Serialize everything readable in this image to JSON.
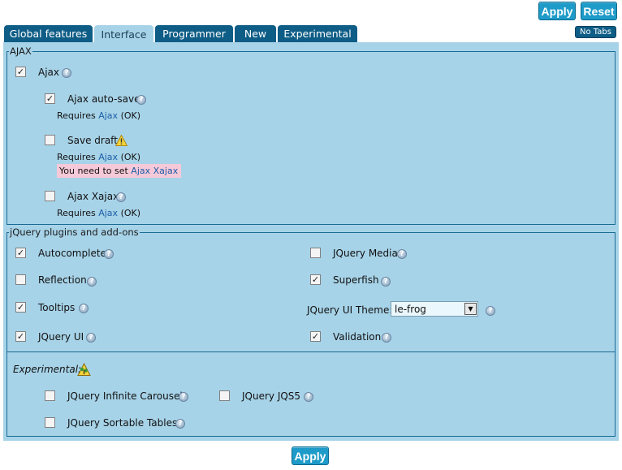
{
  "toolbar": {
    "apply_label": "Apply",
    "reset_label": "Reset"
  },
  "tabs": [
    {
      "label": "Global features",
      "active": false
    },
    {
      "label": "Interface",
      "active": true
    },
    {
      "label": "Programmer",
      "active": false
    },
    {
      "label": "New",
      "active": false
    },
    {
      "label": "Experimental",
      "active": false
    }
  ],
  "no_tabs_label": "No Tabs",
  "ajax_section": {
    "legend": "AJAX",
    "ajax": {
      "label": "Ajax",
      "checked": true
    },
    "autosave": {
      "label": "Ajax auto-save",
      "checked": true,
      "req_prefix": "Requires",
      "req_link": "Ajax",
      "req_status": "(OK)"
    },
    "save_draft": {
      "label": "Save draft",
      "checked": false,
      "req_prefix": "Requires",
      "req_link": "Ajax",
      "req_status": "(OK)",
      "warning_prefix": "You need to set",
      "warning_link": "Ajax Xajax"
    },
    "xajax": {
      "label": "Ajax Xajax",
      "checked": false,
      "req_prefix": "Requires",
      "req_link": "Ajax",
      "req_status": "(OK)"
    }
  },
  "jquery_section": {
    "legend": "jQuery plugins and add-ons",
    "autocomplete": {
      "label": "Autocomplete",
      "checked": true
    },
    "reflection": {
      "label": "Reflection",
      "checked": false
    },
    "tooltips": {
      "label": "Tooltips",
      "checked": true
    },
    "jquery_ui": {
      "label": "JQuery UI",
      "checked": true
    },
    "jquery_media": {
      "label": "JQuery Media",
      "checked": false
    },
    "superfish": {
      "label": "Superfish",
      "checked": true
    },
    "ui_theme": {
      "label": "JQuery UI Theme:",
      "value": "le-frog"
    },
    "validation": {
      "label": "Validation",
      "checked": true
    },
    "experimental": {
      "label": "Experimental:",
      "carousel": {
        "label": "JQuery Infinite Carousel",
        "checked": false
      },
      "jqs5": {
        "label": "JQuery JQS5",
        "checked": false
      },
      "sortable": {
        "label": "JQuery Sortable Tables",
        "checked": false
      }
    }
  },
  "footer": {
    "apply_label": "Apply"
  },
  "colors": {
    "button": "#1e9bc8",
    "tab": "#0e5d86",
    "panel": "#a7d3e8",
    "border": "#1b6a93",
    "warning_bg": "#f6c9d9",
    "link": "#1d5fa8"
  }
}
